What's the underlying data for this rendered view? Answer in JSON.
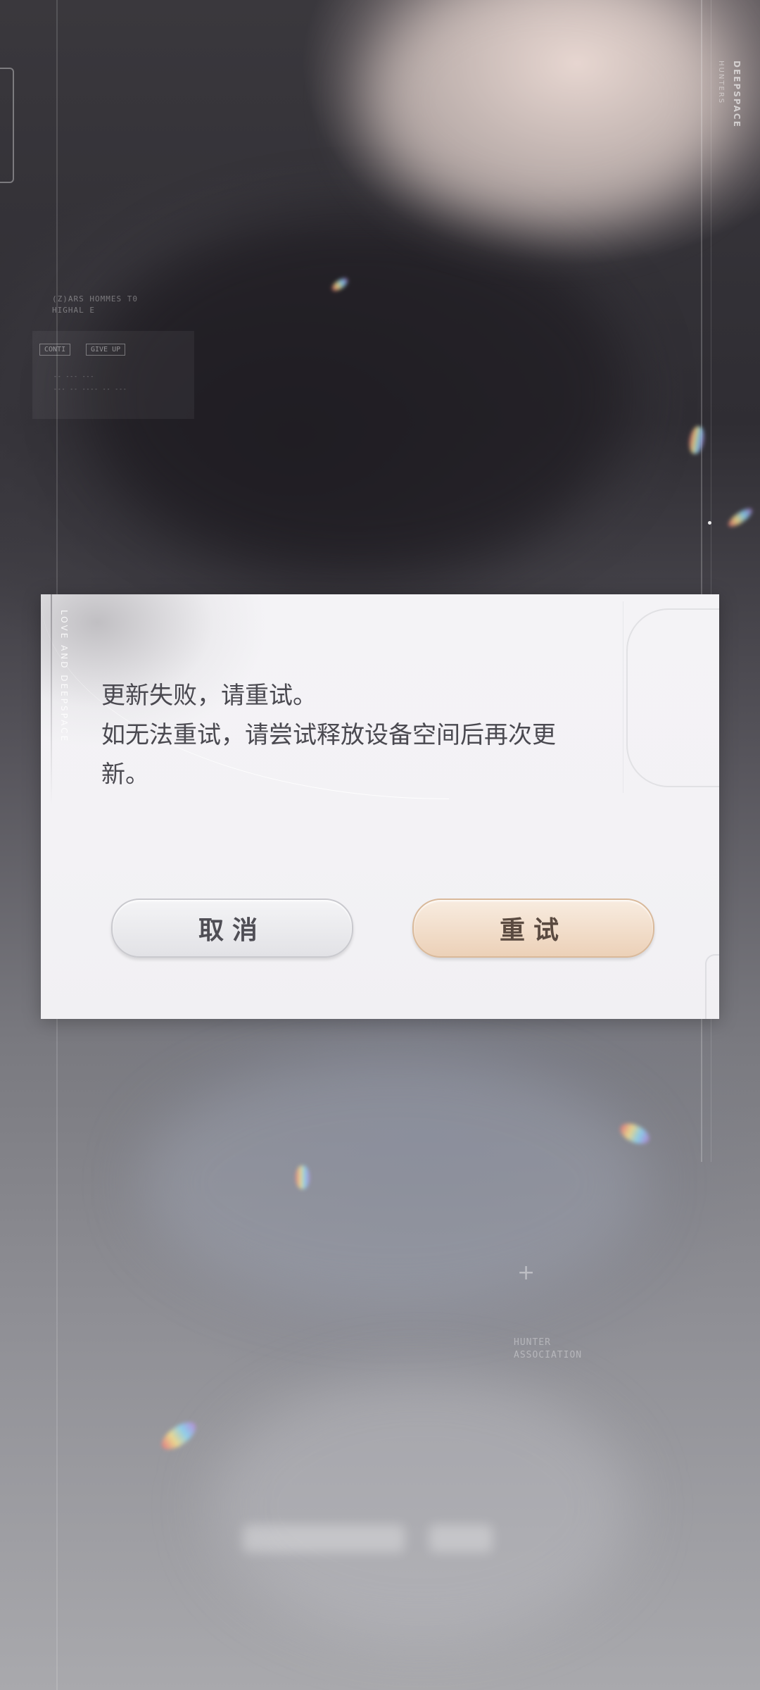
{
  "background": {
    "brand_vertical": "DEEPSPACE",
    "brand_vertical_sub": "HUNTERS",
    "hud_line1": "(Z)ARS HOMMES T0",
    "hud_line2": "HIGHAL E",
    "hud_tag_1": "CONTI",
    "hud_tag_2": "GIVE UP",
    "hud_panel_line1": "-- --- ---",
    "hud_panel_line2": "--- -- ---- -- ---",
    "assoc_line1": "HUNTER",
    "assoc_line2": "ASSOCIATION"
  },
  "dialog": {
    "side_caption": "LOVE AND DEEPSPACE",
    "message_line1": "更新失败，请重试。",
    "message_line2": "如无法重试，请尝试释放设备空间后再次更",
    "message_line3": "新。",
    "cancel_label": "取消",
    "retry_label": "重试"
  },
  "colors": {
    "dialog_bg": "#f4f3f6",
    "message_text": "#4a4950",
    "cancel_bg": "#e8e8ec",
    "retry_bg": "#f1dcc8"
  }
}
